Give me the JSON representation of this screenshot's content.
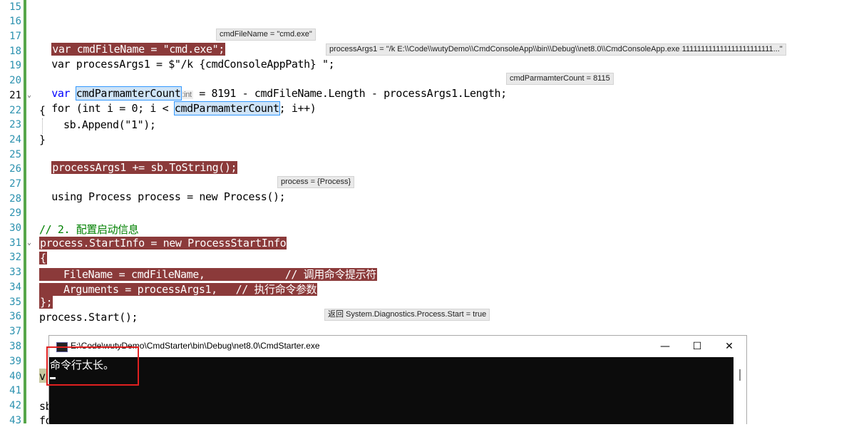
{
  "editor": {
    "line_numbers": [
      "15",
      "16",
      "17",
      "18",
      "19",
      "20",
      "21",
      "22",
      "23",
      "24",
      "25",
      "26",
      "27",
      "28",
      "29",
      "30",
      "31",
      "32",
      "33",
      "34",
      "35",
      "36",
      "37",
      "38",
      "39",
      "40",
      "41",
      "42",
      "43"
    ],
    "lines": {
      "l17": "var cmdFileName = \"cmd.exe\";",
      "l18_a": "var processArgs1 = $\"/k {cmdConsoleAppPath} \";",
      "l20_a": "var ",
      "l20_var": "cmdParmamterCount",
      "l20_hint": ":int",
      "l20_b": " = 8191 - cmdFileName.Length - processArgs1.Length;",
      "l21_a": "for (int i = 0; i < ",
      "l21_var": "cmdParmamterCount",
      "l21_b": "; i++)",
      "l22": "{",
      "l23": "sb.Append(\"1\");",
      "l24": "}",
      "l25": "processArgs1 += sb.ToString();",
      "l27": "using Process process = new Process();",
      "l30": "// 2. 配置启动信息",
      "l31": "process.StartInfo = new ProcessStartInfo",
      "l32": "{",
      "l33": "FileName = cmdFileName,             // 调用命令提示符",
      "l34": "Arguments = processArgs1,   // 执行命令参数",
      "l35": "};",
      "l36": "process.Start();",
      "l40": "v",
      "l42": "sb",
      "l43": "fo"
    },
    "annotations": {
      "a17": "cmdFileName = \"cmd.exe\"",
      "a18": "processArgs1 = \"/k E:\\\\Code\\\\wutyDemo\\\\CmdConsoleApp\\\\bin\\\\Debug\\\\net8.0\\\\CmdConsoleApp.exe 111111111111111111111111...\"",
      "a20": "cmdParmamterCount = 8115",
      "a27": "process = {Process}",
      "a36": "返回 System.Diagnostics.Process.Start = true"
    }
  },
  "console": {
    "title": "E:\\Code\\wutyDemo\\CmdStarter\\bin\\Debug\\net8.0\\CmdStarter.exe",
    "output": "命令行太长。",
    "minimize": "—",
    "maximize": "☐",
    "close": "✕"
  },
  "colors": {
    "breakpoint": "#8b3a3a",
    "keyword": "#0000ff",
    "type": "#2b91af",
    "comment": "#008000",
    "annotation_red_box": "#e02020"
  }
}
